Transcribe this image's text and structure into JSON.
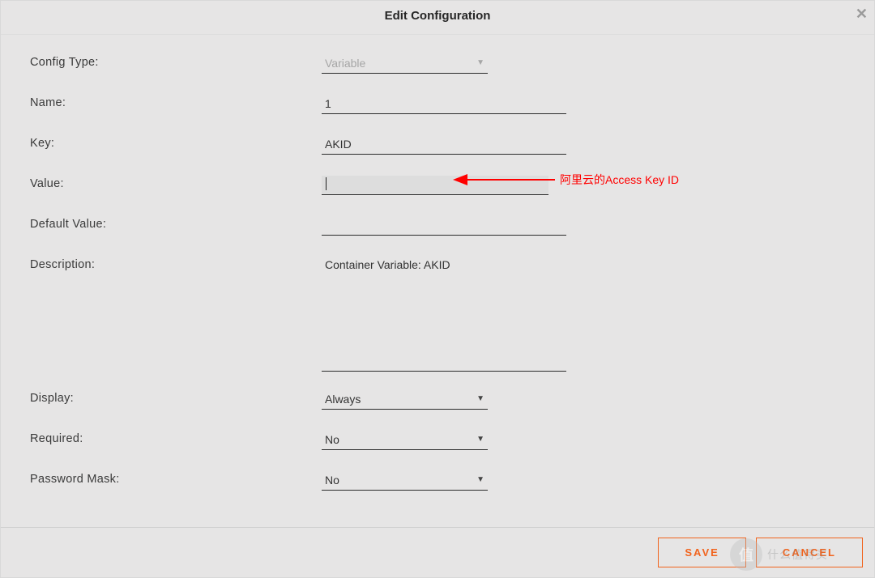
{
  "header": {
    "title": "Edit Configuration"
  },
  "fields": {
    "config_type": {
      "label": "Config Type:",
      "value": "Variable"
    },
    "name": {
      "label": "Name:",
      "value": "1"
    },
    "key": {
      "label": "Key:",
      "value": "AKID"
    },
    "value": {
      "label": "Value:",
      "value": ""
    },
    "default": {
      "label": "Default Value:",
      "value": ""
    },
    "description": {
      "label": "Description:",
      "value": "Container Variable: AKID"
    },
    "display": {
      "label": "Display:",
      "value": "Always"
    },
    "required": {
      "label": "Required:",
      "value": "No"
    },
    "pwmask": {
      "label": "Password Mask:",
      "value": "No"
    }
  },
  "annotation": {
    "text": "阿里云的Access Key ID"
  },
  "footer": {
    "save": "SAVE",
    "cancel": "CANCEL"
  },
  "watermark": {
    "badge": "值",
    "text": "什么值得买"
  }
}
